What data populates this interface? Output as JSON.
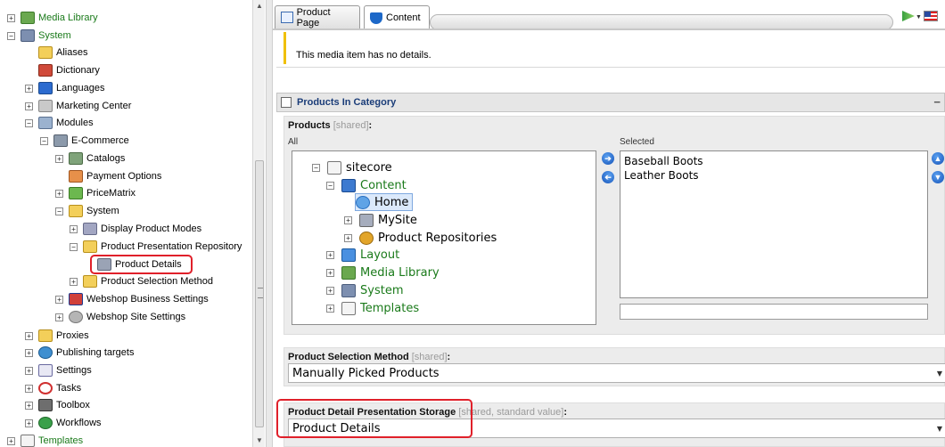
{
  "tree": {
    "items": [
      {
        "label": "Media Library",
        "expander": "+",
        "color": "green"
      },
      {
        "label": "System",
        "expander": "−",
        "color": "green"
      },
      {
        "label": "Aliases"
      },
      {
        "label": "Dictionary"
      },
      {
        "label": "Languages",
        "expander": "+"
      },
      {
        "label": "Marketing Center",
        "expander": "+"
      },
      {
        "label": "Modules",
        "expander": "−"
      },
      {
        "label": "E-Commerce",
        "expander": "−"
      },
      {
        "label": "Catalogs",
        "expander": "+"
      },
      {
        "label": "Payment Options"
      },
      {
        "label": "PriceMatrix",
        "expander": "+"
      },
      {
        "label": "System",
        "expander": "−"
      },
      {
        "label": "Display Product Modes",
        "expander": "+"
      },
      {
        "label": "Product Presentation Repository",
        "expander": "−"
      },
      {
        "label": "Product Details",
        "highlighted": true
      },
      {
        "label": "Product Selection Method",
        "expander": "+"
      },
      {
        "label": "Webshop Business Settings",
        "expander": "+"
      },
      {
        "label": "Webshop Site Settings",
        "expander": "+"
      },
      {
        "label": "Proxies",
        "expander": "+"
      },
      {
        "label": "Publishing targets",
        "expander": "+"
      },
      {
        "label": "Settings",
        "expander": "+"
      },
      {
        "label": "Tasks",
        "expander": "+"
      },
      {
        "label": "Toolbox",
        "expander": "+"
      },
      {
        "label": "Workflows",
        "expander": "+"
      },
      {
        "label": "Templates",
        "expander": "+",
        "color": "green"
      }
    ]
  },
  "tabs": {
    "product_page": "Product Page",
    "content": "Content"
  },
  "message": "This media item has no details.",
  "section": {
    "title": "Products In Category"
  },
  "products_field": {
    "label": "Products",
    "shared": "[shared]",
    "colon": ":",
    "all_label": "All",
    "selected_label": "Selected",
    "tree": [
      {
        "label": "sitecore",
        "expander": "−"
      },
      {
        "label": "Content",
        "expander": "−",
        "color": "green"
      },
      {
        "label": "Home",
        "selected": true
      },
      {
        "label": "MySite",
        "expander": "+"
      },
      {
        "label": "Product Repositories",
        "expander": "+"
      },
      {
        "label": "Layout",
        "expander": "+",
        "color": "green"
      },
      {
        "label": "Media Library",
        "expander": "+",
        "color": "green"
      },
      {
        "label": "System",
        "expander": "+",
        "color": "green"
      },
      {
        "label": "Templates",
        "expander": "+",
        "color": "green"
      }
    ],
    "selected": [
      "Baseball Boots",
      "Leather Boots"
    ]
  },
  "selection_method": {
    "label": "Product Selection Method",
    "shared": "[shared]",
    "colon": ":",
    "value": "Manually Picked Products"
  },
  "detail_storage": {
    "label": "Product Detail Presentation Storage",
    "shared": "[shared, standard value]",
    "colon": ":",
    "value": "Product Details"
  },
  "colors": {
    "accent_red": "#e0202a",
    "tree_green": "#1a7a1a",
    "section_blue": "#1a3c78",
    "warning_bar": "#f0c000"
  },
  "icons": {
    "tab_product_page": "page-icon",
    "tab_content": "content-shield-icon",
    "topright": [
      "flag-go-icon",
      "flag-us-icon"
    ]
  }
}
